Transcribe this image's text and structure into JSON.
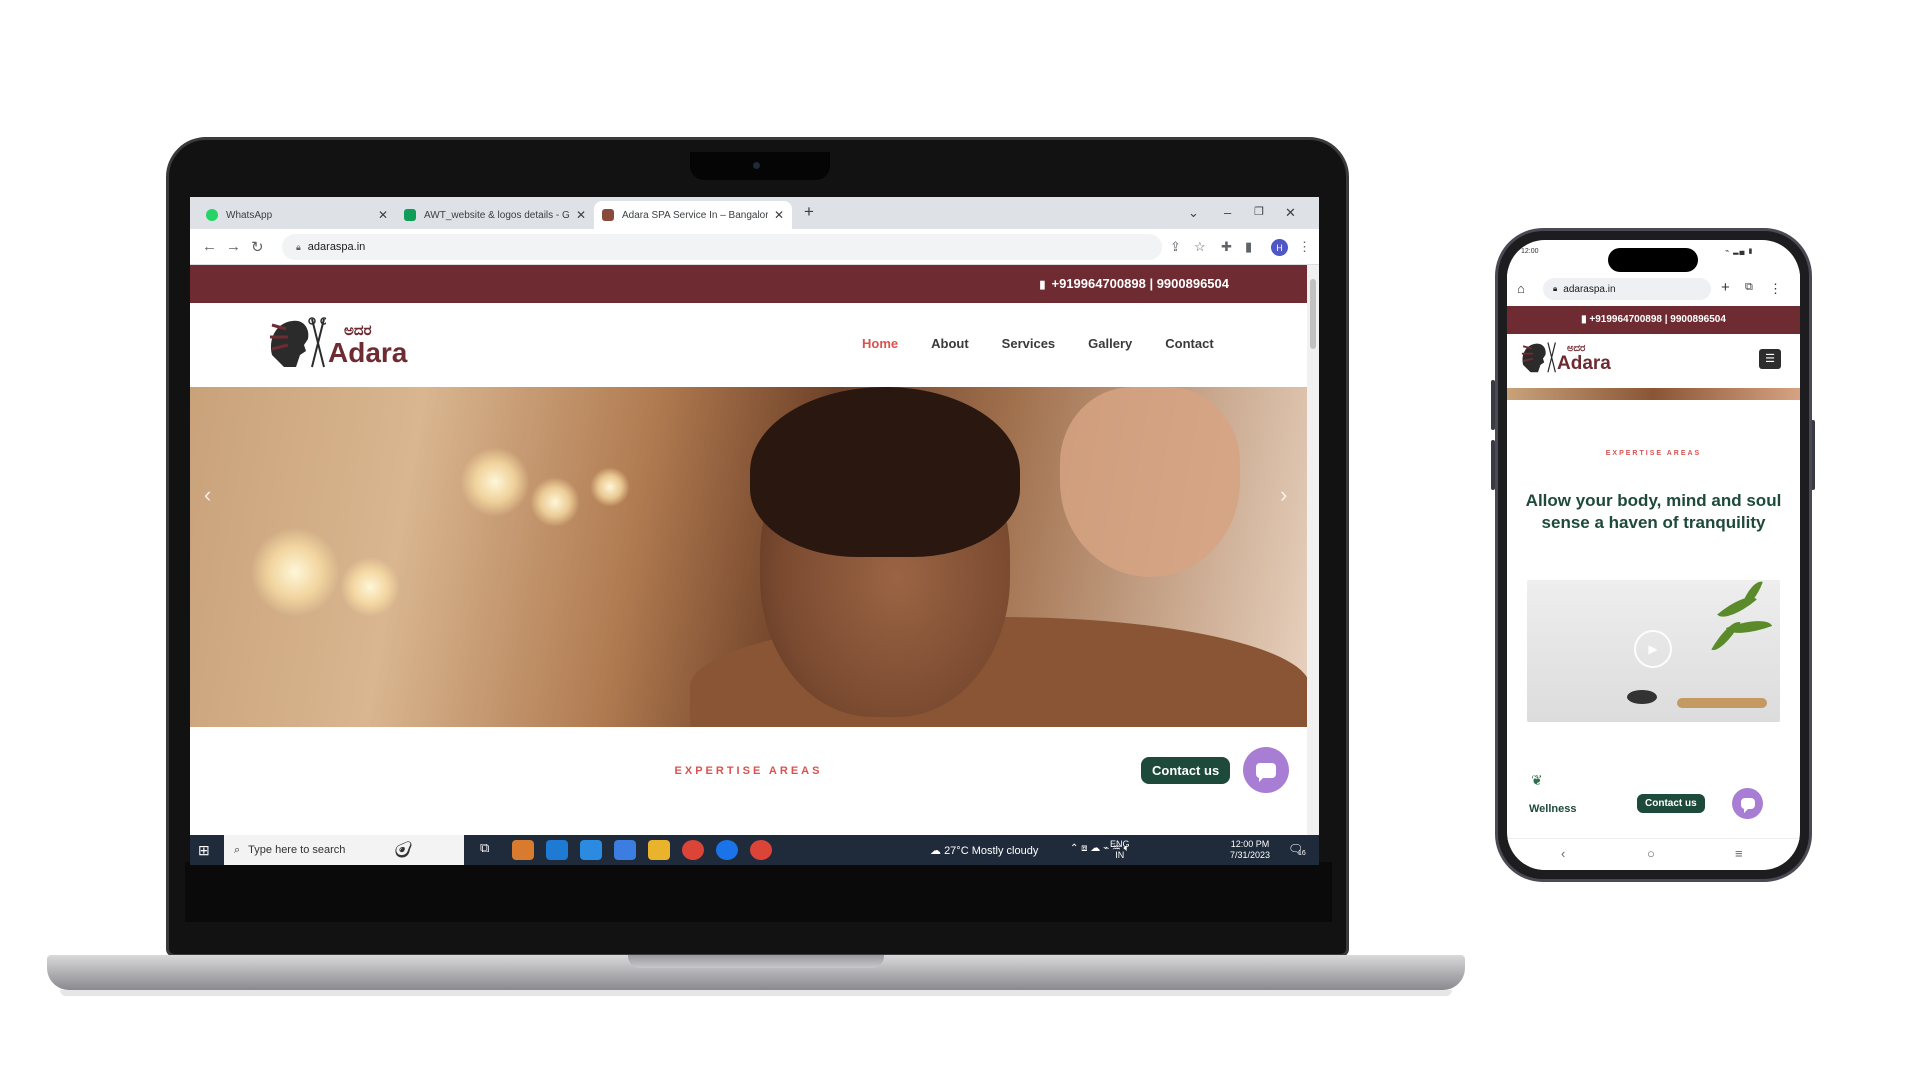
{
  "browser": {
    "tabs": [
      {
        "title": "WhatsApp",
        "favicon_color": "#25d366",
        "active": false
      },
      {
        "title": "AWT_website & logos details - G",
        "favicon_color": "#0f9d58",
        "active": false
      },
      {
        "title": "Adara SPA Service In – Bangalore",
        "favicon_color": "#8a4a3a",
        "active": true
      }
    ],
    "new_tab_label": "+",
    "url": "adaraspa.in",
    "profile_initial": "H"
  },
  "site": {
    "phone_numbers": "+919964700898 | 9900896504",
    "logo": {
      "kannada": "ಅದರ",
      "latin": "Adara"
    },
    "nav": [
      {
        "label": "Home",
        "active": true
      },
      {
        "label": "About",
        "active": false
      },
      {
        "label": "Services",
        "active": false
      },
      {
        "label": "Gallery",
        "active": false
      },
      {
        "label": "Contact",
        "active": false
      }
    ],
    "expertise_label": "EXPERTISE AREAS",
    "contact_button": "Contact us",
    "colors": {
      "brand": "#6e2b32",
      "accent": "#d9534f",
      "green": "#1e4a3b",
      "chat": "#a77ed3"
    }
  },
  "taskbar": {
    "search_placeholder": "Type here to search",
    "weather": "27°C  Mostly cloudy",
    "language": "ENG",
    "region": "IN",
    "time": "12:00 PM",
    "date": "7/31/2023",
    "notification_count": "16"
  },
  "phone": {
    "status_time": "12:00",
    "url": "adaraspa.in",
    "phone_numbers": "+919964700898 | 9900896504",
    "logo": {
      "kannada": "ಅದರ",
      "latin": "Adara"
    },
    "expertise_label": "EXPERTISE AREAS",
    "headline": "Allow your body, mind and soul sense a haven of tranquility",
    "section_label": "Wellness",
    "contact_button": "Contact us"
  }
}
